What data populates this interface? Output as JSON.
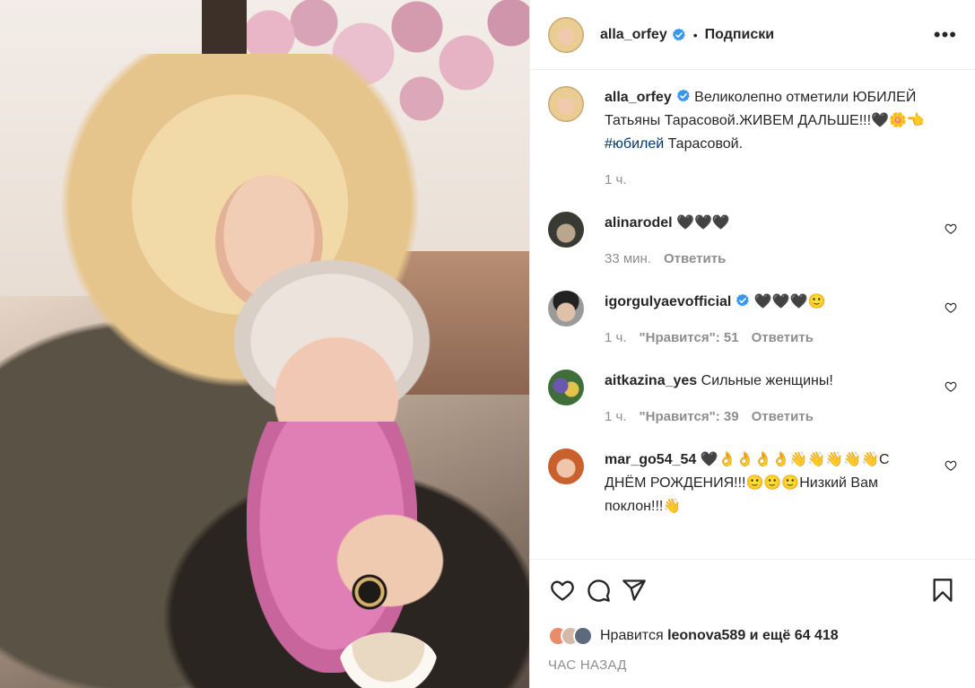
{
  "post": {
    "author": "alla_orfey",
    "separator": "•",
    "follow_label": "Подписки",
    "more_label": "•••"
  },
  "caption": {
    "username": "alla_orfey",
    "text": "Великолепно отметили ЮБИЛЕЙ Татьяны Тарасовой.ЖИВЕМ ДАЛЬШЕ!!!🖤🌼👈",
    "hashtag": "#юбилей",
    "text_after": "Тарасовой.",
    "time": "1 ч."
  },
  "comments": [
    {
      "username": "alinarodel",
      "verified": false,
      "text": "🖤🖤🖤",
      "time": "33 мин.",
      "likes": "",
      "reply": "Ответить"
    },
    {
      "username": "igorgulyaevofficial",
      "verified": true,
      "text": "🖤🖤🖤🙂",
      "time": "1 ч.",
      "likes": "\"Нравится\": 51",
      "reply": "Ответить"
    },
    {
      "username": "aitkazina_yes",
      "verified": false,
      "text": "Сильные женщины!",
      "time": "1 ч.",
      "likes": "\"Нравится\": 39",
      "reply": "Ответить"
    },
    {
      "username": "mar_go54_54",
      "verified": false,
      "text": "🖤👌👌👌👌👋👋👋👋👋С ДНЁМ РОЖДЕНИЯ!!!🙂🙂🙂Низкий Вам поклон!!!👋",
      "time": "",
      "likes": "",
      "reply": ""
    }
  ],
  "likes": {
    "prefix": "Нравится",
    "user": "leonova589",
    "suffix": "и ещё 64 418"
  },
  "timestamp": "ЧАС НАЗАД",
  "icons": {
    "like": "heart-icon",
    "comment": "comment-icon",
    "share": "share-icon",
    "save": "bookmark-icon",
    "verified": "verified-badge-icon"
  },
  "colors": {
    "text": "#262626",
    "muted": "#8e8e8e",
    "verified": "#3897f0",
    "hashtag": "#00376b",
    "border": "#efefef"
  }
}
